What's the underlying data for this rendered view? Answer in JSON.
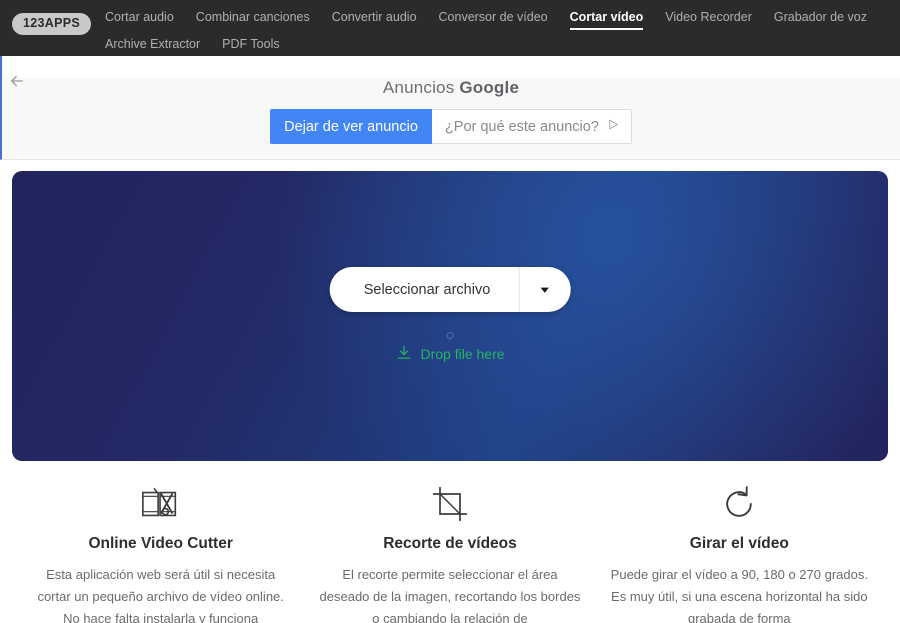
{
  "brand": {
    "logo_text": "123APPS"
  },
  "nav": {
    "items": [
      {
        "label": "Cortar audio",
        "active": false
      },
      {
        "label": "Combinar canciones",
        "active": false
      },
      {
        "label": "Convertir audio",
        "active": false
      },
      {
        "label": "Conversor de vídeo",
        "active": false
      },
      {
        "label": "Cortar vídeo",
        "active": true
      },
      {
        "label": "Video Recorder",
        "active": false
      },
      {
        "label": "Grabador de voz",
        "active": false
      },
      {
        "label": "Archive Extractor",
        "active": false
      },
      {
        "label": "PDF Tools",
        "active": false
      }
    ]
  },
  "ad": {
    "back_icon": "arrow-left-icon",
    "title_prefix": "Anuncios ",
    "title_brand": "Google",
    "stop_button": "Dejar de ver anuncio",
    "why_button": "¿Por qué este anuncio?",
    "why_icon": "ad-info-icon",
    "accent_blue": "#4285f4"
  },
  "hero": {
    "select_label": "Seleccionar archivo",
    "caret_icon": "chevron-down-icon",
    "drop_icon": "download-icon",
    "drop_label": "Drop file here",
    "drop_color": "#24b563",
    "gradient_from": "#22235c",
    "gradient_to": "#1f3f84"
  },
  "features": [
    {
      "icon": "film-scissors-icon",
      "title": "Online Video Cutter",
      "text": "Esta aplicación web será útil si necesita cortar un pequeño archivo de vídeo online. No hace falta instalarla y funciona"
    },
    {
      "icon": "crop-icon",
      "title": "Recorte de vídeos",
      "text": "El recorte permite seleccionar el área deseado de la imagen, recortando los bordes o cambiando la relación de"
    },
    {
      "icon": "rotate-icon",
      "title": "Girar el vídeo",
      "text": "Puede girar el vídeo a 90, 180 o 270 grados. Es muy útil, si una escena horizontal ha sido grabada de forma"
    }
  ]
}
